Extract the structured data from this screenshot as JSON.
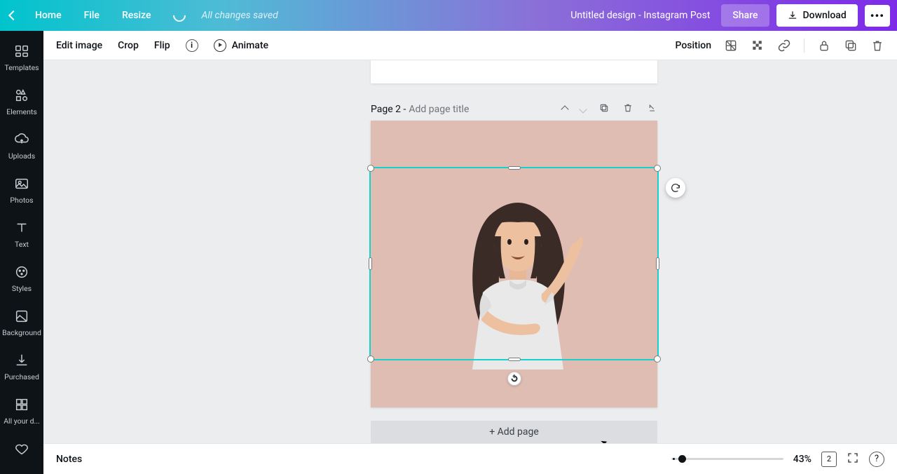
{
  "topbar": {
    "home": "Home",
    "file": "File",
    "resize": "Resize",
    "saved": "All changes saved",
    "title": "Untitled design - Instagram Post",
    "share": "Share",
    "download": "Download"
  },
  "sidebar": {
    "items": [
      {
        "label": "Templates"
      },
      {
        "label": "Elements"
      },
      {
        "label": "Uploads"
      },
      {
        "label": "Photos"
      },
      {
        "label": "Text"
      },
      {
        "label": "Styles"
      },
      {
        "label": "Background"
      },
      {
        "label": "Purchased"
      },
      {
        "label": "All your d..."
      }
    ]
  },
  "ctx": {
    "edit_image": "Edit image",
    "crop": "Crop",
    "flip": "Flip",
    "animate": "Animate",
    "position": "Position"
  },
  "page": {
    "label": "Page 2 -",
    "title_placeholder": "Add page title",
    "add_page": "+ Add page",
    "bg_color": "#dfbdb3"
  },
  "bottombar": {
    "notes": "Notes",
    "zoom": "43%",
    "page_count": "2",
    "help": "?"
  }
}
